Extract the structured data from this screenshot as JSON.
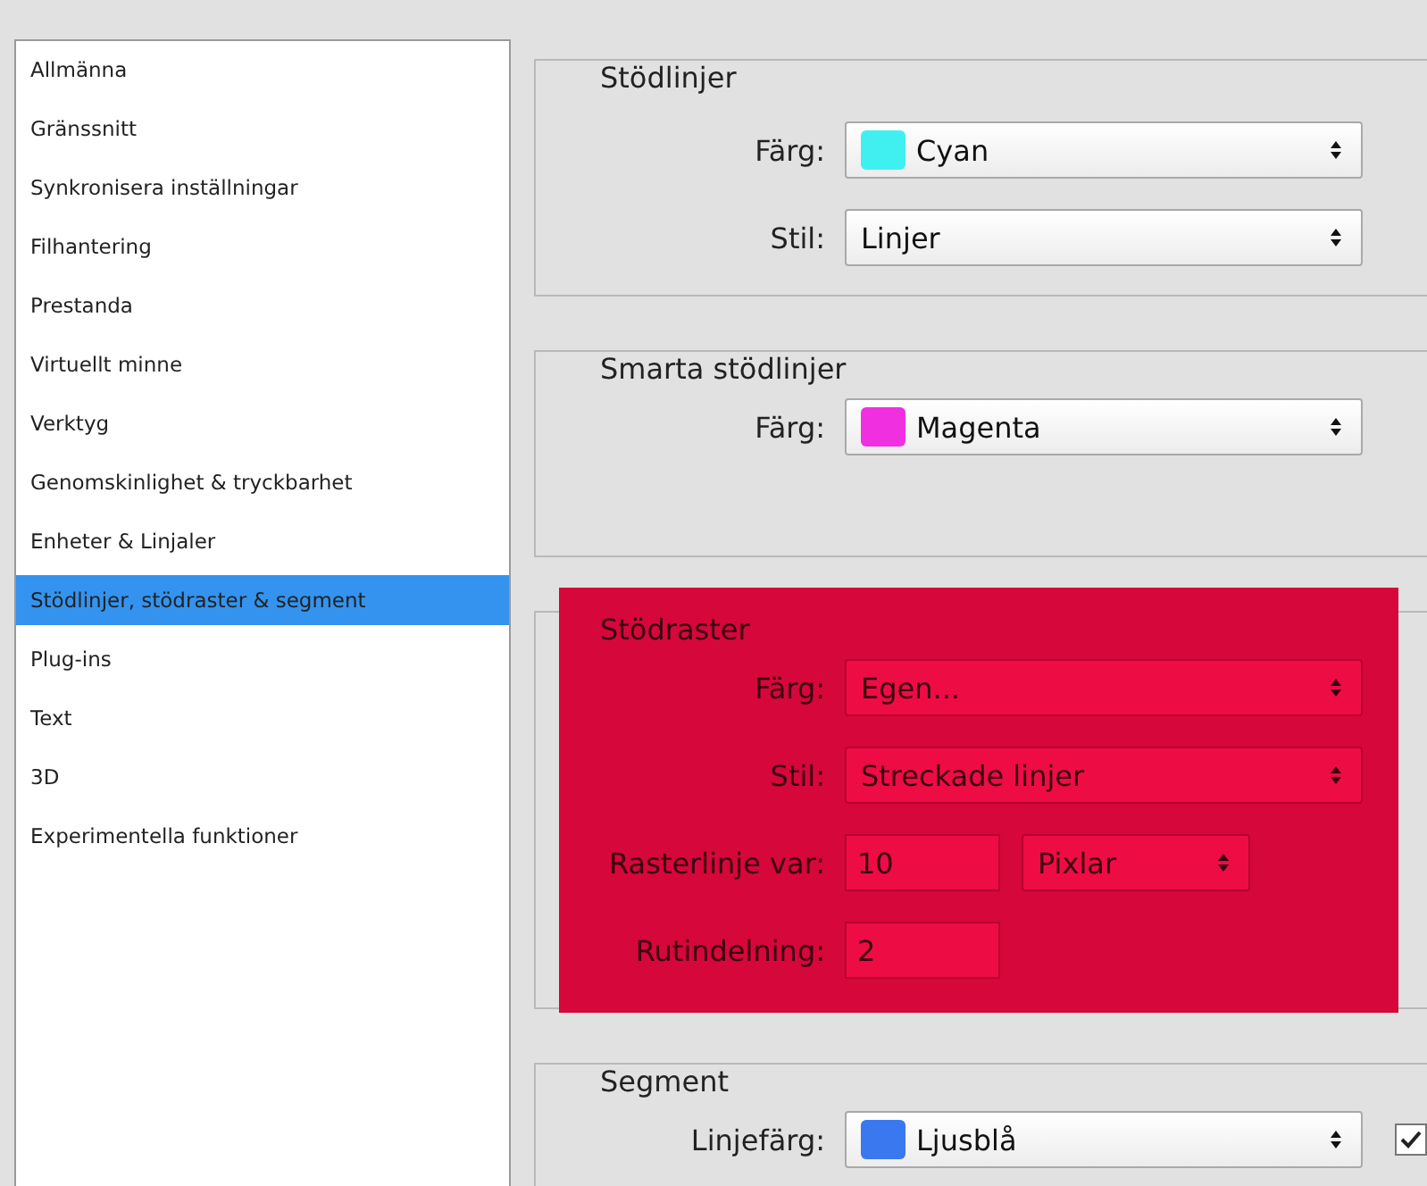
{
  "sidebar": {
    "items": [
      {
        "label": "Allmänna",
        "selected": false
      },
      {
        "label": "Gränssnitt",
        "selected": false
      },
      {
        "label": "Synkronisera inställningar",
        "selected": false
      },
      {
        "label": "Filhantering",
        "selected": false
      },
      {
        "label": "Prestanda",
        "selected": false
      },
      {
        "label": "Virtuellt minne",
        "selected": false
      },
      {
        "label": "Verktyg",
        "selected": false
      },
      {
        "label": "Genomskinlighet & tryckbarhet",
        "selected": false
      },
      {
        "label": "Enheter & Linjaler",
        "selected": false
      },
      {
        "label": "Stödlinjer, stödraster & segment",
        "selected": true
      },
      {
        "label": "Plug-ins",
        "selected": false
      },
      {
        "label": "Text",
        "selected": false
      },
      {
        "label": "3D",
        "selected": false
      },
      {
        "label": "Experimentella funktioner",
        "selected": false
      }
    ]
  },
  "groups": [
    {
      "title": "Stödlinjer",
      "highlighted": false,
      "rows": [
        {
          "kind": "select",
          "label": "Färg:",
          "value": "Cyan",
          "color": "#40f0f0"
        },
        {
          "kind": "select",
          "label": "Stil:",
          "value": "Linjer"
        }
      ]
    },
    {
      "title": "Smarta stödlinjer",
      "highlighted": false,
      "rows": [
        {
          "kind": "select",
          "label": "Färg:",
          "value": "Magenta",
          "color": "#f030e0"
        }
      ]
    },
    {
      "title": "Stödraster",
      "highlighted": true,
      "rows": [
        {
          "kind": "select",
          "label": "Färg:",
          "value": "Egen..."
        },
        {
          "kind": "select",
          "label": "Stil:",
          "value": "Streckade linjer"
        },
        {
          "kind": "number",
          "label": "Rasterlinje var:",
          "value": "10",
          "unit": "Pixlar"
        },
        {
          "kind": "number",
          "label": "Rutindelning:",
          "value": "2"
        }
      ]
    },
    {
      "title": "Segment",
      "highlighted": false,
      "rows": [
        {
          "kind": "select",
          "label": "Linjefärg:",
          "value": "Ljusblå",
          "color": "#3a78f0",
          "checkbox": {
            "checked": true
          }
        }
      ]
    }
  ]
}
